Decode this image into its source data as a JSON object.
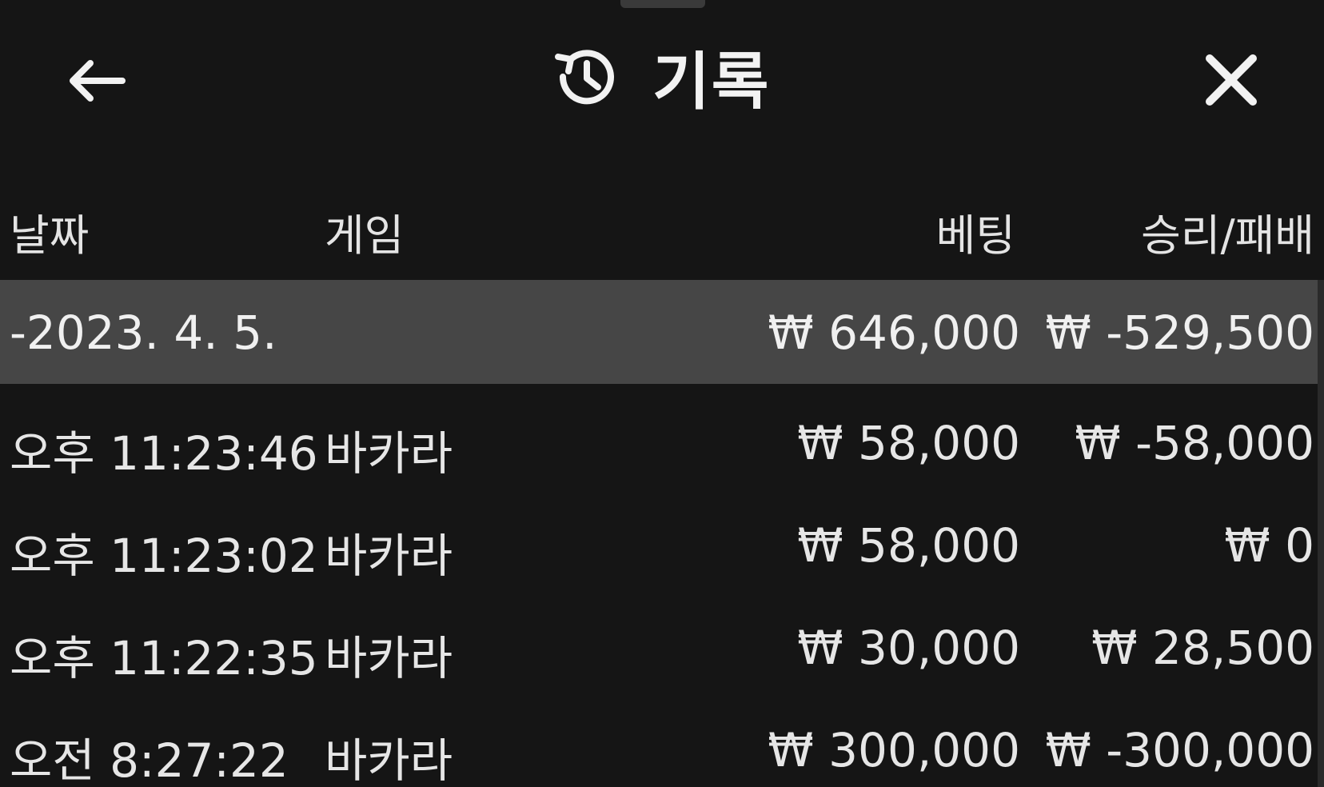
{
  "header": {
    "title": "기록",
    "back_icon": "arrow-left-icon",
    "history_icon": "history-icon",
    "close_icon": "close-icon"
  },
  "columns": {
    "date": "날짜",
    "game": "게임",
    "bet": "베팅",
    "win_loss": "승리/패배"
  },
  "date_group": {
    "date": "-2023. 4. 5.",
    "bet_total": "₩ 646,000",
    "win_loss_total": "₩ -529,500"
  },
  "rows": [
    {
      "time": "오후 11:23:46",
      "game": "바카라",
      "bet": "₩ 58,000",
      "win_loss": "₩ -58,000"
    },
    {
      "time": "오후 11:23:02",
      "game": "바카라",
      "bet": "₩ 58,000",
      "win_loss": "₩ 0"
    },
    {
      "time": "오후 11:22:35",
      "game": "바카라",
      "bet": "₩ 30,000",
      "win_loss": "₩ 28,500"
    },
    {
      "time": "오전 8:27:22",
      "game": "바카라",
      "bet": "₩ 300,000",
      "win_loss": "₩ -300,000"
    }
  ],
  "colors": {
    "background": "#151515",
    "date_row_bg": "#464646",
    "text": "#e6e6e6"
  }
}
